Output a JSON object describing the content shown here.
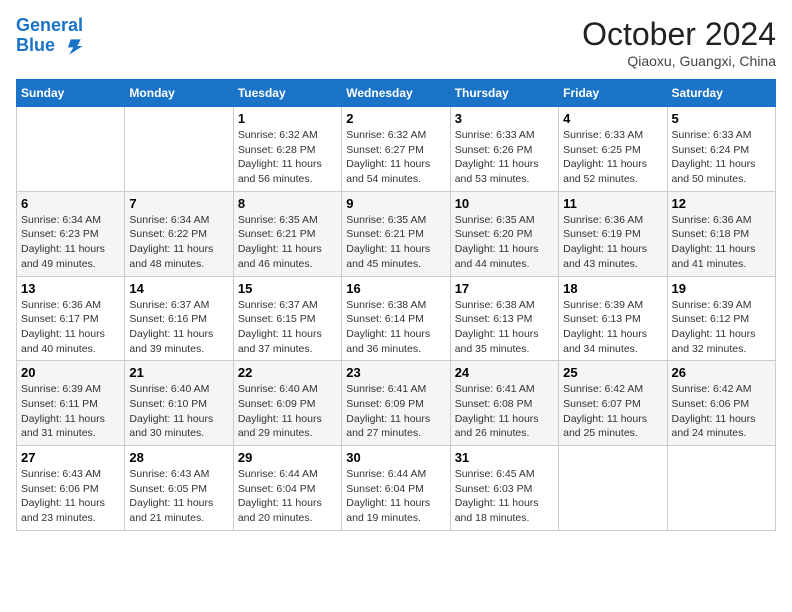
{
  "header": {
    "logo_line1": "General",
    "logo_line2": "Blue",
    "month": "October 2024",
    "location": "Qiaoxu, Guangxi, China"
  },
  "weekdays": [
    "Sunday",
    "Monday",
    "Tuesday",
    "Wednesday",
    "Thursday",
    "Friday",
    "Saturday"
  ],
  "weeks": [
    [
      {
        "day": "",
        "info": ""
      },
      {
        "day": "",
        "info": ""
      },
      {
        "day": "1",
        "info": "Sunrise: 6:32 AM\nSunset: 6:28 PM\nDaylight: 11 hours and 56 minutes."
      },
      {
        "day": "2",
        "info": "Sunrise: 6:32 AM\nSunset: 6:27 PM\nDaylight: 11 hours and 54 minutes."
      },
      {
        "day": "3",
        "info": "Sunrise: 6:33 AM\nSunset: 6:26 PM\nDaylight: 11 hours and 53 minutes."
      },
      {
        "day": "4",
        "info": "Sunrise: 6:33 AM\nSunset: 6:25 PM\nDaylight: 11 hours and 52 minutes."
      },
      {
        "day": "5",
        "info": "Sunrise: 6:33 AM\nSunset: 6:24 PM\nDaylight: 11 hours and 50 minutes."
      }
    ],
    [
      {
        "day": "6",
        "info": "Sunrise: 6:34 AM\nSunset: 6:23 PM\nDaylight: 11 hours and 49 minutes."
      },
      {
        "day": "7",
        "info": "Sunrise: 6:34 AM\nSunset: 6:22 PM\nDaylight: 11 hours and 48 minutes."
      },
      {
        "day": "8",
        "info": "Sunrise: 6:35 AM\nSunset: 6:21 PM\nDaylight: 11 hours and 46 minutes."
      },
      {
        "day": "9",
        "info": "Sunrise: 6:35 AM\nSunset: 6:21 PM\nDaylight: 11 hours and 45 minutes."
      },
      {
        "day": "10",
        "info": "Sunrise: 6:35 AM\nSunset: 6:20 PM\nDaylight: 11 hours and 44 minutes."
      },
      {
        "day": "11",
        "info": "Sunrise: 6:36 AM\nSunset: 6:19 PM\nDaylight: 11 hours and 43 minutes."
      },
      {
        "day": "12",
        "info": "Sunrise: 6:36 AM\nSunset: 6:18 PM\nDaylight: 11 hours and 41 minutes."
      }
    ],
    [
      {
        "day": "13",
        "info": "Sunrise: 6:36 AM\nSunset: 6:17 PM\nDaylight: 11 hours and 40 minutes."
      },
      {
        "day": "14",
        "info": "Sunrise: 6:37 AM\nSunset: 6:16 PM\nDaylight: 11 hours and 39 minutes."
      },
      {
        "day": "15",
        "info": "Sunrise: 6:37 AM\nSunset: 6:15 PM\nDaylight: 11 hours and 37 minutes."
      },
      {
        "day": "16",
        "info": "Sunrise: 6:38 AM\nSunset: 6:14 PM\nDaylight: 11 hours and 36 minutes."
      },
      {
        "day": "17",
        "info": "Sunrise: 6:38 AM\nSunset: 6:13 PM\nDaylight: 11 hours and 35 minutes."
      },
      {
        "day": "18",
        "info": "Sunrise: 6:39 AM\nSunset: 6:13 PM\nDaylight: 11 hours and 34 minutes."
      },
      {
        "day": "19",
        "info": "Sunrise: 6:39 AM\nSunset: 6:12 PM\nDaylight: 11 hours and 32 minutes."
      }
    ],
    [
      {
        "day": "20",
        "info": "Sunrise: 6:39 AM\nSunset: 6:11 PM\nDaylight: 11 hours and 31 minutes."
      },
      {
        "day": "21",
        "info": "Sunrise: 6:40 AM\nSunset: 6:10 PM\nDaylight: 11 hours and 30 minutes."
      },
      {
        "day": "22",
        "info": "Sunrise: 6:40 AM\nSunset: 6:09 PM\nDaylight: 11 hours and 29 minutes."
      },
      {
        "day": "23",
        "info": "Sunrise: 6:41 AM\nSunset: 6:09 PM\nDaylight: 11 hours and 27 minutes."
      },
      {
        "day": "24",
        "info": "Sunrise: 6:41 AM\nSunset: 6:08 PM\nDaylight: 11 hours and 26 minutes."
      },
      {
        "day": "25",
        "info": "Sunrise: 6:42 AM\nSunset: 6:07 PM\nDaylight: 11 hours and 25 minutes."
      },
      {
        "day": "26",
        "info": "Sunrise: 6:42 AM\nSunset: 6:06 PM\nDaylight: 11 hours and 24 minutes."
      }
    ],
    [
      {
        "day": "27",
        "info": "Sunrise: 6:43 AM\nSunset: 6:06 PM\nDaylight: 11 hours and 23 minutes."
      },
      {
        "day": "28",
        "info": "Sunrise: 6:43 AM\nSunset: 6:05 PM\nDaylight: 11 hours and 21 minutes."
      },
      {
        "day": "29",
        "info": "Sunrise: 6:44 AM\nSunset: 6:04 PM\nDaylight: 11 hours and 20 minutes."
      },
      {
        "day": "30",
        "info": "Sunrise: 6:44 AM\nSunset: 6:04 PM\nDaylight: 11 hours and 19 minutes."
      },
      {
        "day": "31",
        "info": "Sunrise: 6:45 AM\nSunset: 6:03 PM\nDaylight: 11 hours and 18 minutes."
      },
      {
        "day": "",
        "info": ""
      },
      {
        "day": "",
        "info": ""
      }
    ]
  ]
}
